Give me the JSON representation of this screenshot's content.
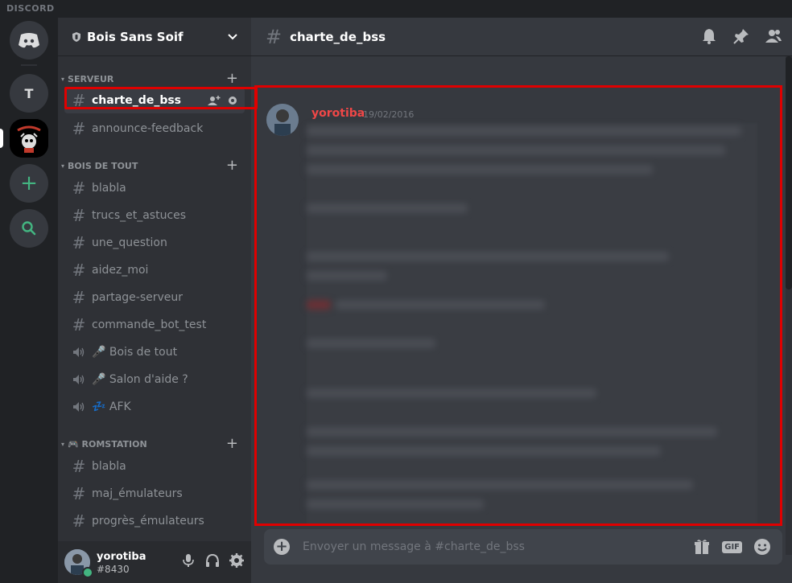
{
  "titlebar": {
    "brand": "DISCORD"
  },
  "guilds": {
    "t_label": "T"
  },
  "server": {
    "name": "Bois Sans Soif"
  },
  "categories": [
    {
      "label": "SERVEUR"
    },
    {
      "label": "BOIS DE TOUT"
    },
    {
      "label": "🎮 ROMSTATION"
    }
  ],
  "channels": {
    "serveur": [
      "charte_de_bss",
      "announce-feedback"
    ],
    "bois": [
      "blabla",
      "trucs_et_astuces",
      "une_question",
      "aidez_moi",
      "partage-serveur",
      "commande_bot_test"
    ],
    "voice": [
      "🎤 Bois de tout",
      "🎤 Salon d'aide ?",
      "💤 AFK"
    ],
    "rom": [
      "blabla",
      "maj_émulateurs",
      "progrès_émulateurs"
    ]
  },
  "user": {
    "name": "yorotiba",
    "tag": "#8430"
  },
  "channel_header": {
    "title": "charte_de_bss"
  },
  "message": {
    "author": "yorotiba",
    "timestamp": "19/02/2016"
  },
  "composer": {
    "placeholder": "Envoyer un message à #charte_de_bss",
    "gif_label": "GIF"
  },
  "colors": {
    "accent_red": "#e00000",
    "online": "#43b581",
    "author": "#f04747"
  }
}
